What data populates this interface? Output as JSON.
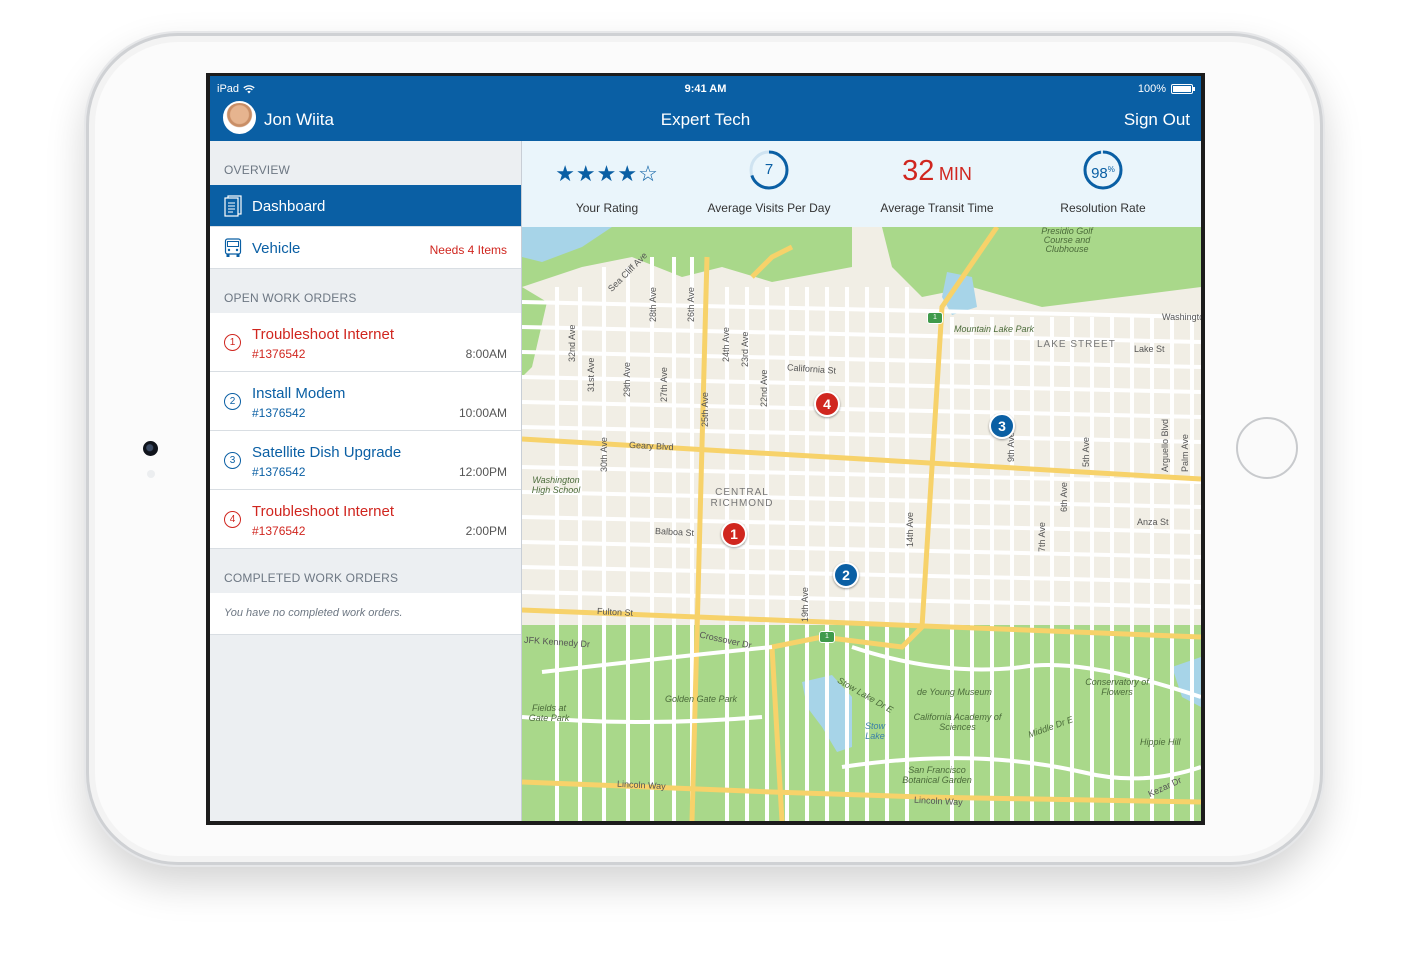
{
  "status_bar": {
    "carrier": "iPad",
    "time": "9:41 AM",
    "battery": "100%"
  },
  "header": {
    "user_name": "Jon Wiita",
    "title": "Expert Tech",
    "sign_out": "Sign Out"
  },
  "sidebar": {
    "overview_header": "OVERVIEW",
    "dashboard_label": "Dashboard",
    "vehicle_label": "Vehicle",
    "vehicle_badge": "Needs 4 Items",
    "open_orders_header": "OPEN WORK ORDERS",
    "open_orders": [
      {
        "num": "1",
        "title": "Troubleshoot Internet",
        "id": "#1376542",
        "time": "8:00AM",
        "status": "red"
      },
      {
        "num": "2",
        "title": "Install Modem",
        "id": "#1376542",
        "time": "10:00AM",
        "status": "blue"
      },
      {
        "num": "3",
        "title": "Satellite Dish Upgrade",
        "id": "#1376542",
        "time": "12:00PM",
        "status": "blue"
      },
      {
        "num": "4",
        "title": "Troubleshoot Internet",
        "id": "#1376542",
        "time": "2:00PM",
        "status": "red"
      }
    ],
    "completed_header": "COMPLETED WORK ORDERS",
    "completed_empty": "You have no completed work orders."
  },
  "stats": {
    "rating": {
      "stars": "★★★★☆",
      "value": 4,
      "max": 5,
      "label": "Your Rating"
    },
    "visits": {
      "value": "7",
      "label": "Average Visits Per Day",
      "ring_fraction": 0.7
    },
    "transit": {
      "value": "32",
      "unit": "MIN",
      "label": "Average Transit Time"
    },
    "resolution": {
      "value": "98",
      "unit": "%",
      "label": "Resolution Rate",
      "ring_fraction": 0.98
    }
  },
  "map": {
    "pins": [
      {
        "num": "1",
        "status": "red"
      },
      {
        "num": "2",
        "status": "blue"
      },
      {
        "num": "3",
        "status": "blue"
      },
      {
        "num": "4",
        "status": "red"
      }
    ],
    "streets": {
      "sea_cliff": "Sea Cliff Ave",
      "28th": "28th Ave",
      "26th": "26th Ave",
      "24th": "24th Ave",
      "23rd": "23rd Ave",
      "32nd": "32nd Ave",
      "31st": "31st Ave",
      "29th": "29th Ave",
      "27th": "27th Ave",
      "25th": "25th Ave",
      "22nd": "22nd Ave",
      "california": "California St",
      "lake_st": "Lake St",
      "lake_street": "LAKE STREET",
      "mountain_lake": "Mountain Lake Park",
      "geary": "Geary Blvd",
      "balboa": "Balboa St",
      "fulton": "Fulton St",
      "crossover": "Crossover Dr",
      "kennedy": "JFK Kennedy Dr",
      "lincoln": "Lincoln Way",
      "lincoln2": "Lincoln Way",
      "anza": "Anza St",
      "kezar": "Kezar Dr",
      "9th": "9th Ave",
      "5th": "5th Ave",
      "arguello": "Arguello Blvd",
      "palm": "Palm Ave",
      "14th": "14th Ave",
      "7th": "7th Ave",
      "6th": "6th Ave",
      "19th": "19th Ave",
      "30th": "30th Ave",
      "washington": "Washington"
    },
    "places": {
      "presidio": "Presidio Golf Course and Clubhouse",
      "washington_hs": "Washington High School",
      "central_richmond": "CENTRAL RICHMOND",
      "golden_gate": "Golden Gate Park",
      "fields": "Fields at Gate Park",
      "de_young": "de Young Museum",
      "academy": "California Academy of Sciences",
      "conservatory": "Conservatory of Flowers",
      "stow_lake": "Stow Lake",
      "stow_lake_dr": "Stow Lake Dr E",
      "hippie": "Hippie Hill",
      "botanical": "San Francisco Botanical Garden",
      "middle_dr": "Middle Dr E"
    }
  },
  "colors": {
    "brand_blue": "#0a5fa4",
    "alert_red": "#d0261f",
    "park_green": "#a9d88a",
    "water_blue": "#a7d4e8"
  },
  "icons": [
    "wifi-icon",
    "battery-icon",
    "avatar",
    "dashboard-icon",
    "vehicle-icon",
    "star-icon",
    "map-pin"
  ]
}
